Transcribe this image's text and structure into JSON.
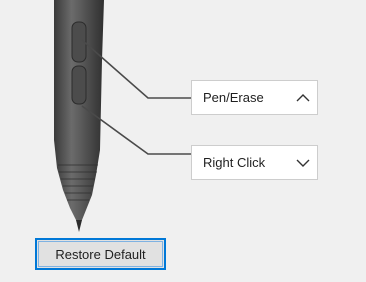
{
  "pen_buttons": {
    "upper": {
      "label": "Pen/Erase",
      "chevron": "chevron-up-icon"
    },
    "lower": {
      "label": "Right Click",
      "chevron": "chevron-down-icon"
    }
  },
  "restore_button": {
    "label": "Restore Default"
  },
  "colors": {
    "background": "#f0f0f0",
    "button_focus_border": "#0078d7",
    "pen_body": "#5a5a5a",
    "pen_dark": "#3a3a3a",
    "leader_line": "#4a4a4a"
  }
}
